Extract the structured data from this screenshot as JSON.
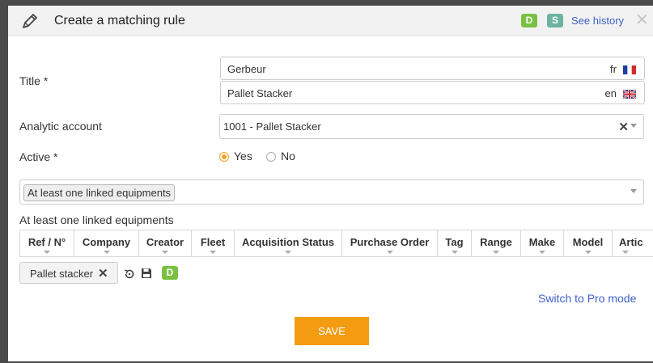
{
  "header": {
    "title": "Create a matching rule",
    "badge_d": "D",
    "badge_s": "S",
    "history_link": "See history",
    "close_glyph": "✕"
  },
  "form": {
    "title_label": "Title *",
    "title_fr": {
      "value": "Gerbeur",
      "lang": "fr"
    },
    "title_en": {
      "value": "Pallet Stacker",
      "lang": "en"
    },
    "analytic_label": "Analytic account",
    "analytic_value": "1001 - Pallet Stacker",
    "active_label": "Active *",
    "active_yes": "Yes",
    "active_no": "No",
    "active_selected": "Yes"
  },
  "criteria": {
    "selected_chip": "At least one linked equipments",
    "section_title": "At least one linked equipments",
    "columns": [
      "Ref / N°",
      "Company",
      "Creator",
      "Fleet",
      "Acquisition Status",
      "Purchase Order",
      "Tag",
      "Range",
      "Make",
      "Model",
      "Artic"
    ]
  },
  "selection": {
    "tag_label": "Pallet stacker",
    "badge_d": "D"
  },
  "footer": {
    "pro_mode_link": "Switch to Pro mode",
    "save_label": "SAVE"
  },
  "colors": {
    "accent": "#f39c12",
    "link": "#3e5fc8",
    "badge_d": "#7ac143",
    "badge_s": "#6bb4a1"
  },
  "icons": [
    "pencil-icon",
    "flag-fr-icon",
    "flag-uk-icon",
    "clear-icon",
    "chevron-down-icon",
    "undo-icon",
    "save-icon",
    "close-icon"
  ]
}
